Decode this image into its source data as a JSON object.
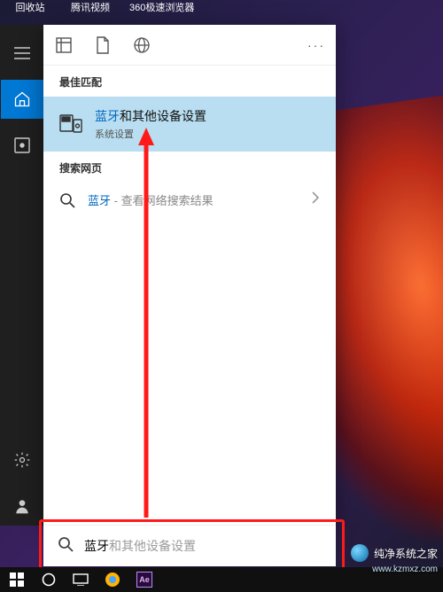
{
  "desktop_icons": [
    "回收站",
    "腾讯视频",
    "360极速浏览器"
  ],
  "panel": {
    "best_match_label": "最佳匹配",
    "best_match": {
      "title_hl": "蓝牙",
      "title_rest": "和其他设备设置",
      "subtitle": "系统设置"
    },
    "web_label": "搜索网页",
    "web_item": {
      "hl": "蓝牙",
      "sub": " - 查看网络搜索结果"
    }
  },
  "search": {
    "typed": "蓝牙",
    "ghost": "和其他设备设置"
  },
  "watermark": {
    "text": "纯净系统之家",
    "url": "www.kzmxz.com"
  }
}
